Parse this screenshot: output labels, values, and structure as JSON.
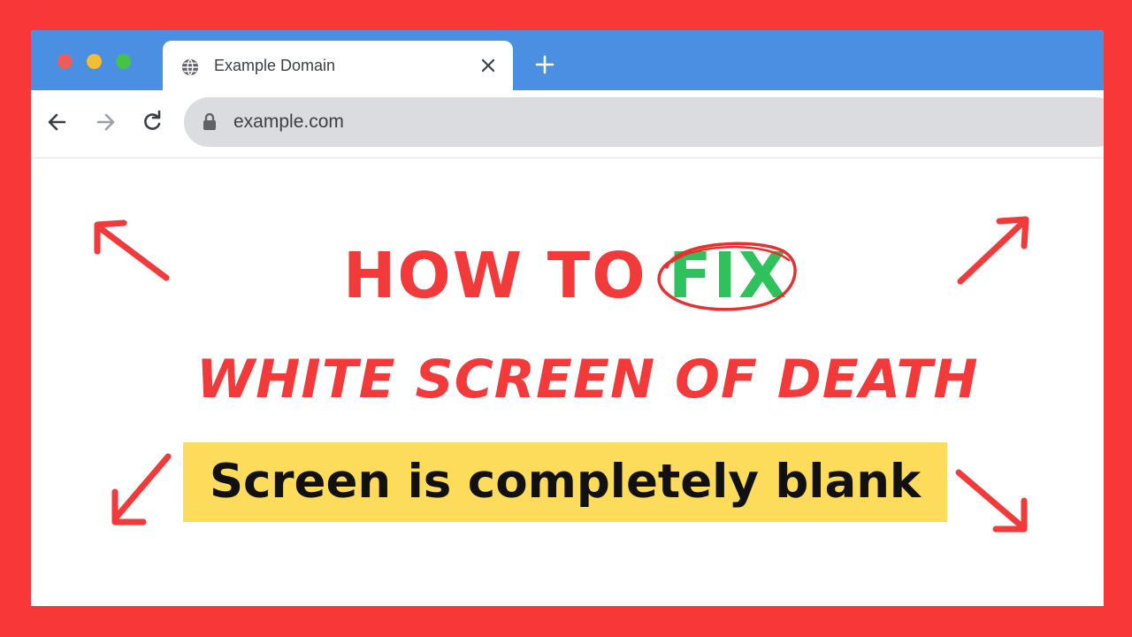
{
  "browser": {
    "tab": {
      "title": "Example Domain",
      "icon": "globe-icon",
      "close_icon": "close-icon"
    },
    "new_tab_icon": "plus-icon",
    "toolbar": {
      "back_icon": "arrow-left-icon",
      "forward_icon": "arrow-right-icon",
      "reload_icon": "reload-icon"
    },
    "omnibox": {
      "lock_icon": "lock-icon",
      "url": "example.com"
    }
  },
  "thumbnail": {
    "line1": "HOW TO",
    "fix_word": "FIX",
    "line2": "WHITE SCREEN OF DEATH",
    "line3": "Screen is completely blank",
    "arrows": [
      "arrow-up-left-icon",
      "arrow-up-right-icon",
      "arrow-down-left-icon",
      "arrow-down-right-icon"
    ]
  },
  "colors": {
    "frame": "#f83838",
    "tabstrip": "#4b8fe3",
    "headline_red": "#f33a3a",
    "fix_green": "#2fc15b",
    "highlight_yellow": "#fddc5c"
  }
}
